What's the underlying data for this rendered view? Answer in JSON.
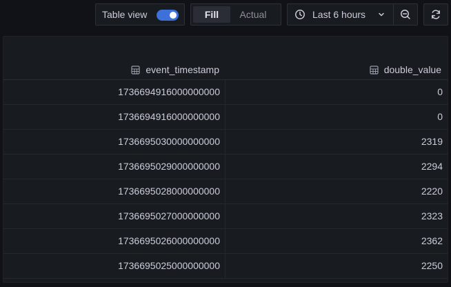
{
  "toolbar": {
    "table_view_label": "Table view",
    "table_view_enabled": true,
    "fill_label": "Fill",
    "actual_label": "Actual",
    "time_range_label": "Last 6 hours",
    "icons": {
      "clock": "clock-icon",
      "chevron": "chevron-down-icon",
      "zoom_out": "zoom-out-icon",
      "refresh": "refresh-icon"
    }
  },
  "table": {
    "columns": [
      {
        "label": "event_timestamp",
        "icon": "table-column-icon"
      },
      {
        "label": "double_value",
        "icon": "table-column-icon"
      }
    ],
    "rows": [
      {
        "event_timestamp": "1736694916000000000",
        "double_value": "0"
      },
      {
        "event_timestamp": "1736694916000000000",
        "double_value": "0"
      },
      {
        "event_timestamp": "1736695030000000000",
        "double_value": "2319"
      },
      {
        "event_timestamp": "1736695029000000000",
        "double_value": "2294"
      },
      {
        "event_timestamp": "1736695028000000000",
        "double_value": "2220"
      },
      {
        "event_timestamp": "1736695027000000000",
        "double_value": "2323"
      },
      {
        "event_timestamp": "1736695026000000000",
        "double_value": "2362"
      },
      {
        "event_timestamp": "1736695025000000000",
        "double_value": "2250"
      }
    ]
  },
  "colors": {
    "background": "#111217",
    "panel": "#181b1f",
    "accent": "#3d71d9",
    "text": "#ccccdc"
  }
}
